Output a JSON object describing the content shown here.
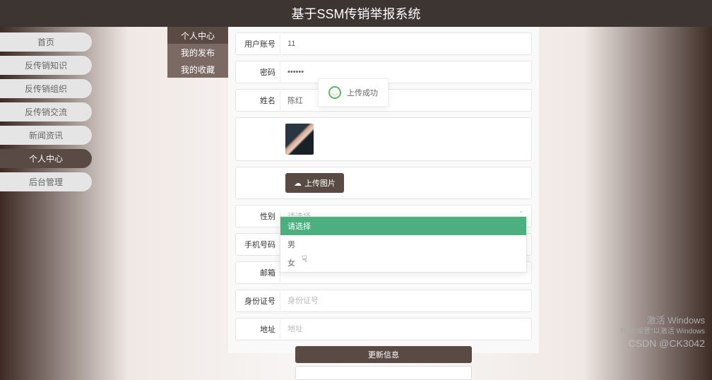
{
  "header": {
    "title": "基于SSM传销举报系统"
  },
  "leftNav": [
    "首页",
    "反传销知识",
    "反传销组织",
    "反传销交流",
    "新闻资讯",
    "个人中心",
    "后台管理"
  ],
  "leftNavActive": 5,
  "subNav": [
    "个人中心",
    "我的发布",
    "我的收藏"
  ],
  "subNavActive": 0,
  "toast": {
    "message": "上传成功"
  },
  "form": {
    "account_label": "用户账号",
    "account_value": "11",
    "password_label": "密码",
    "password_value": "••••••",
    "name_label": "姓名",
    "name_value": "陈红",
    "gender_label": "性别",
    "gender_placeholder": "请选择",
    "phone_label": "手机号码",
    "email_label": "邮箱",
    "idcard_label": "身份证号",
    "idcard_placeholder": "身份证号",
    "address_label": "地址",
    "address_placeholder": "地址"
  },
  "dropdown": {
    "options": [
      "请选择",
      "男",
      "女"
    ],
    "selected": 0
  },
  "upload_btn": "上传图片",
  "submit_btn": "更新信息",
  "watermark": {
    "line1": "激活 Windows",
    "line2": "转到\"设置\"以激活 Windows"
  },
  "csdn": "CSDN @CK3042"
}
